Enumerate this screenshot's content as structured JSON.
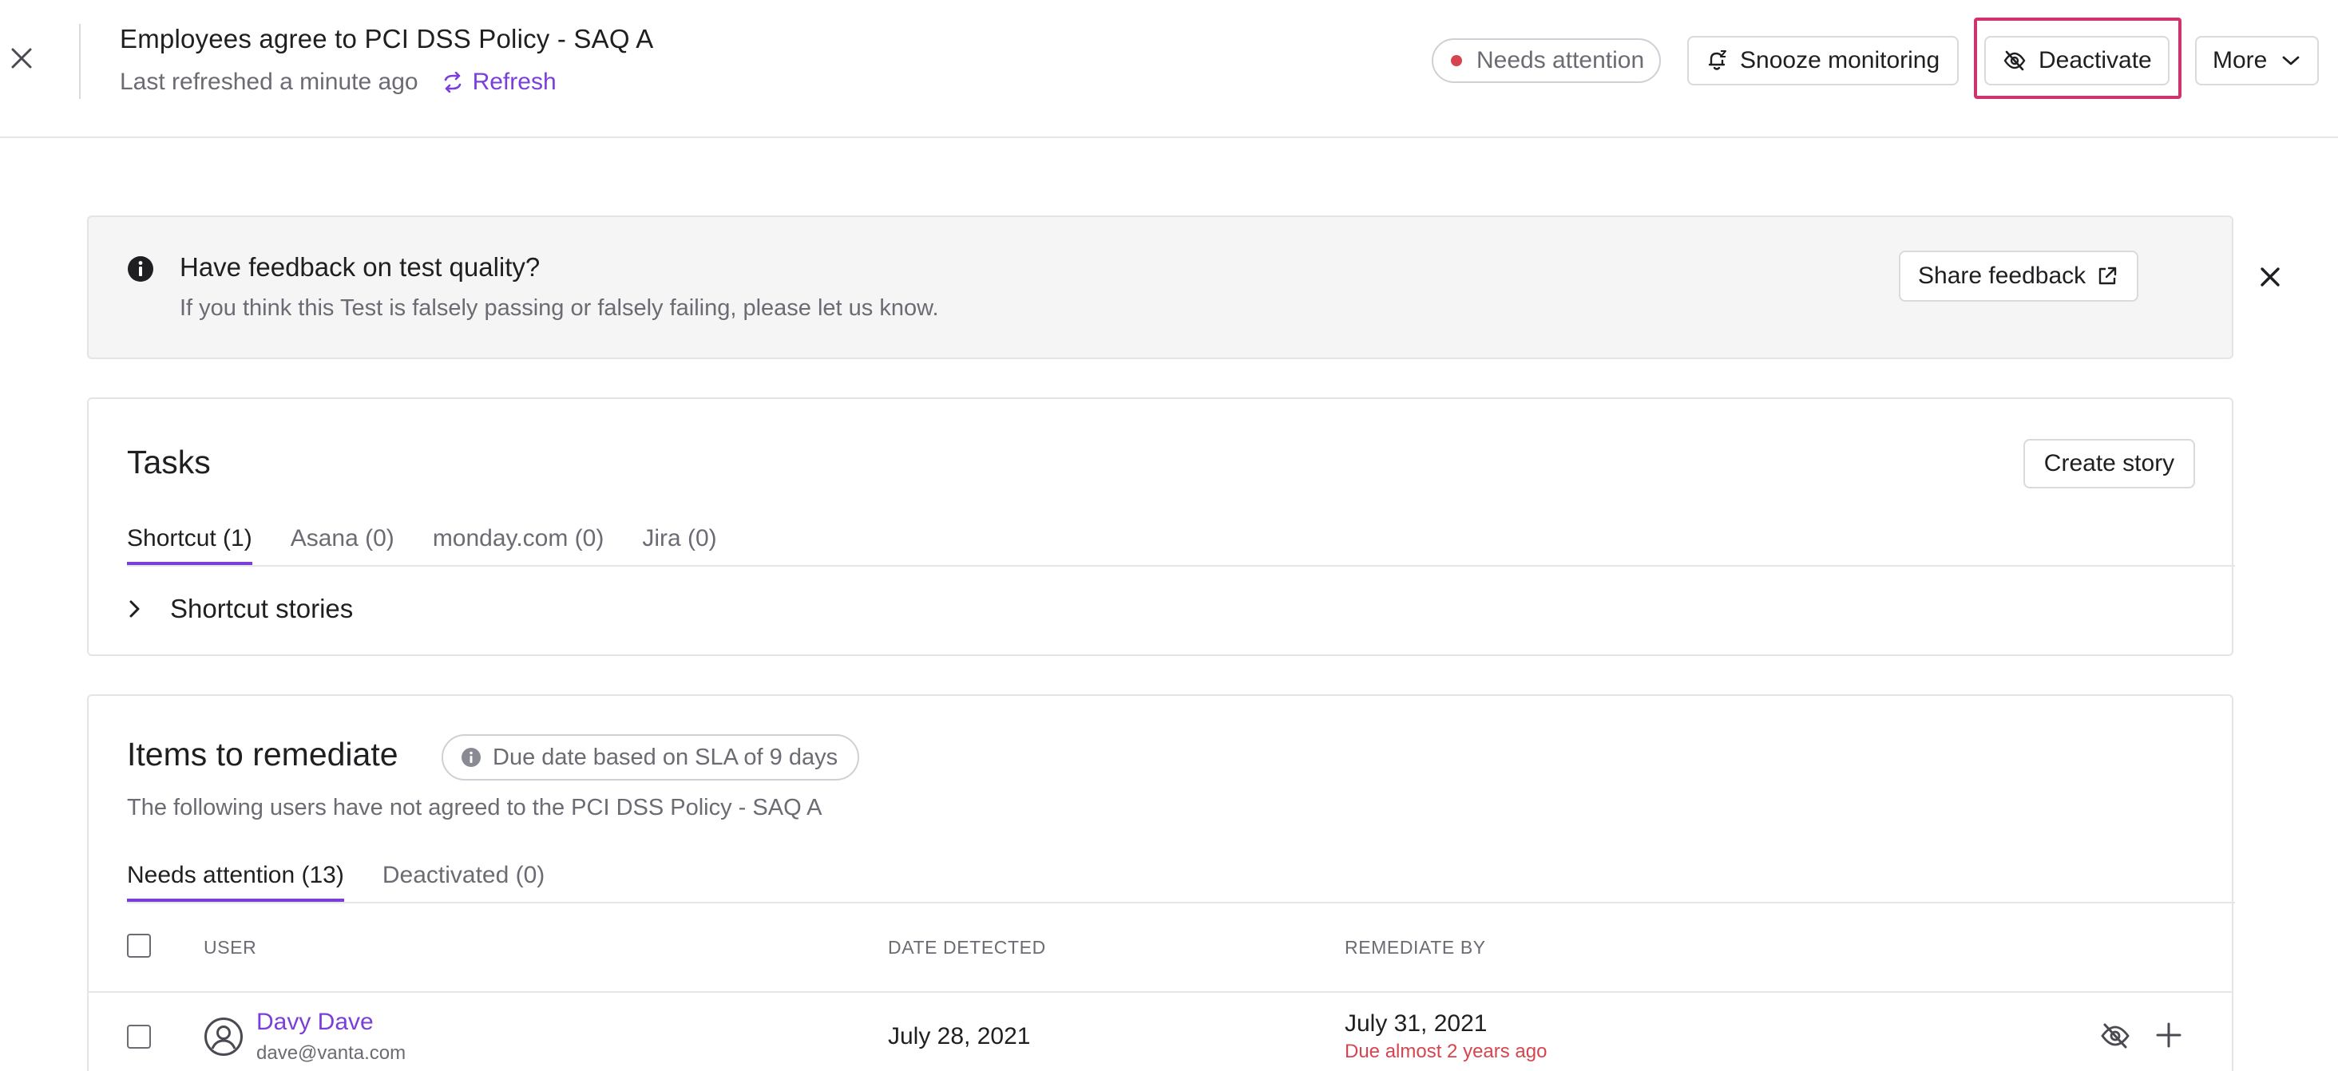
{
  "header": {
    "title": "Employees agree to PCI DSS Policy - SAQ A",
    "last_refreshed": "Last refreshed a minute ago",
    "refresh_label": "Refresh",
    "status_label": "Needs attention",
    "status_color": "#d6454f",
    "snooze_label": "Snooze monitoring",
    "deactivate_label": "Deactivate",
    "more_label": "More",
    "highlight_color": "#d0336e",
    "accent_color": "#7b3fd9"
  },
  "banner": {
    "title": "Have feedback on test quality?",
    "subtitle": "If you think this Test is falsely passing or falsely failing, please let us know.",
    "share_label": "Share feedback"
  },
  "tasks": {
    "title": "Tasks",
    "create_label": "Create story",
    "tabs": [
      {
        "label": "Shortcut (1)"
      },
      {
        "label": "Asana (0)"
      },
      {
        "label": "monday.com (0)"
      },
      {
        "label": "Jira (0)"
      }
    ],
    "stories_label": "Shortcut stories"
  },
  "items": {
    "title": "Items to remediate",
    "sla_label": "Due date based on SLA of 9 days",
    "description": "The following users have not agreed to the PCI DSS Policy - SAQ A",
    "tabs": [
      {
        "label": "Needs attention (13)"
      },
      {
        "label": "Deactivated (0)"
      }
    ],
    "columns": {
      "user": "USER",
      "date_detected": "DATE DETECTED",
      "remediate_by": "REMEDIATE BY"
    },
    "rows": [
      {
        "name": "Davy Dave",
        "email": "dave@vanta.com",
        "date_detected": "July 28, 2021",
        "remediate_by": "July 31, 2021",
        "due_note": "Due almost 2 years ago"
      }
    ]
  },
  "icons": {
    "close": "close-icon",
    "refresh": "refresh-icon",
    "snooze": "bell-snooze-icon",
    "deactivate": "eye-off-icon",
    "more": "chevron-down-icon",
    "info": "info-icon",
    "external": "external-link-icon",
    "expand": "chevron-right-icon",
    "avatar": "user-circle-icon",
    "add": "plus-icon"
  }
}
